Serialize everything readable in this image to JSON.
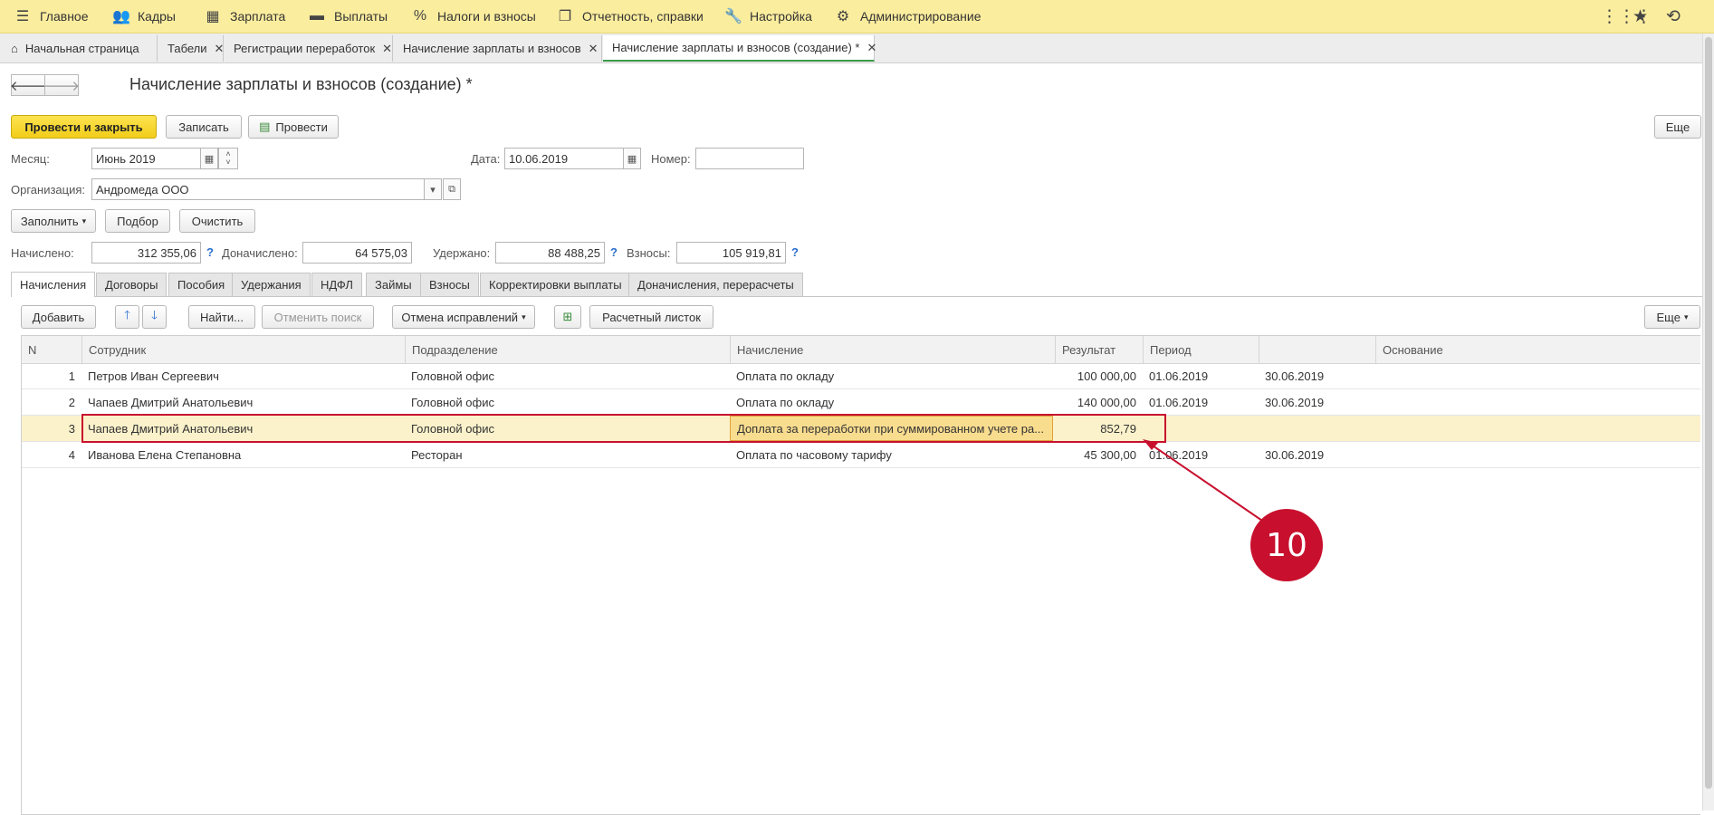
{
  "topmenu": {
    "items": [
      {
        "label": "Главное",
        "icon": "menu-icon"
      },
      {
        "label": "Кадры",
        "icon": "people-icon"
      },
      {
        "label": "Зарплата",
        "icon": "calculator-icon"
      },
      {
        "label": "Выплаты",
        "icon": "wallet-icon"
      },
      {
        "label": "Налоги и взносы",
        "icon": "percent-icon"
      },
      {
        "label": "Отчетность, справки",
        "icon": "report-icon"
      },
      {
        "label": "Настройка",
        "icon": "wrench-icon"
      },
      {
        "label": "Администрирование",
        "icon": "gear-icon"
      }
    ],
    "right_icons": [
      "grid-icon",
      "star-icon",
      "history-icon"
    ]
  },
  "tabs": [
    {
      "label": "Начальная страница",
      "closable": false
    },
    {
      "label": "Табели",
      "closable": true
    },
    {
      "label": "Регистрации переработок",
      "closable": true
    },
    {
      "label": "Начисление зарплаты и взносов",
      "closable": true
    },
    {
      "label": "Начисление зарплаты и взносов (создание) *",
      "closable": true,
      "active": true
    }
  ],
  "form": {
    "title": "Начисление зарплаты и взносов (создание) *",
    "toolbar": {
      "post_and_close": "Провести и закрыть",
      "save": "Записать",
      "post": "Провести",
      "more": "Еще"
    },
    "month_label": "Месяц:",
    "month_value": "Июнь 2019",
    "date_label": "Дата:",
    "date_value": "10.06.2019",
    "number_label": "Номер:",
    "number_value": "",
    "org_label": "Организация:",
    "org_value": "Андромеда ООО",
    "fill_button": "Заполнить",
    "select_button": "Подбор",
    "clear_button": "Очистить",
    "totals": {
      "accrued_label": "Начислено:",
      "accrued_value": "312 355,06",
      "additional_label": "Доначислено:",
      "additional_value": "64 575,03",
      "withheld_label": "Удержано:",
      "withheld_value": "88 488,25",
      "contributions_label": "Взносы:",
      "contributions_value": "105 919,81",
      "help": "?"
    }
  },
  "form_tabs": [
    {
      "label": "Начисления",
      "active": true
    },
    {
      "label": "Договоры"
    },
    {
      "label": "Пособия"
    },
    {
      "label": "Удержания"
    },
    {
      "label": "НДФЛ"
    },
    {
      "label": "Займы"
    },
    {
      "label": "Взносы"
    },
    {
      "label": "Корректировки выплаты"
    },
    {
      "label": "Доначисления, перерасчеты"
    }
  ],
  "table_toolbar": {
    "add": "Добавить",
    "find": "Найти...",
    "cancel_search": "Отменить поиск",
    "cancel_fix": "Отмена исправлений",
    "payslip": "Расчетный листок",
    "more": "Еще"
  },
  "table": {
    "columns": [
      "N",
      "Сотрудник",
      "Подразделение",
      "Начисление",
      "Результат",
      "Период",
      "",
      "Основание"
    ],
    "rows": [
      {
        "n": "1",
        "employee": "Петров Иван Сергеевич",
        "department": "Головной офис",
        "accrual": "Оплата по окладу",
        "result": "100 000,00",
        "period_from": "01.06.2019",
        "period_to": "30.06.2019",
        "basis": ""
      },
      {
        "n": "2",
        "employee": "Чапаев Дмитрий Анатольевич",
        "department": "Головной офис",
        "accrual": "Оплата по окладу",
        "result": "140 000,00",
        "period_from": "01.06.2019",
        "period_to": "30.06.2019",
        "basis": ""
      },
      {
        "n": "3",
        "employee": "Чапаев Дмитрий Анатольевич",
        "department": "Головной офис",
        "accrual": "Доплата за переработки при суммированном учете ра...",
        "result": "852,79",
        "period_from": "",
        "period_to": "",
        "basis": "",
        "selected": true
      },
      {
        "n": "4",
        "employee": "Иванова Елена Степановна",
        "department": "Ресторан",
        "accrual": "Оплата по часовому тарифу",
        "result": "45 300,00",
        "period_from": "01.06.2019",
        "period_to": "30.06.2019",
        "basis": ""
      }
    ]
  },
  "callout": {
    "number": "10"
  },
  "colors": {
    "topbar": "#fbed9e",
    "accent_yellow": "#f1cd1a",
    "highlight_red": "#c8102e",
    "selected_row": "#fbf2cb"
  }
}
